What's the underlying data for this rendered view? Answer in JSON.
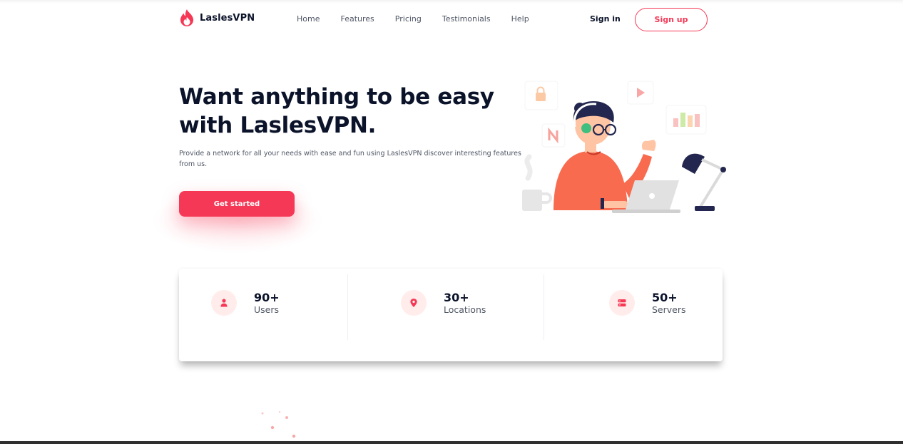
{
  "brand": {
    "name": "LaslesVPN",
    "color": "#f53855"
  },
  "nav": {
    "items": [
      {
        "label": "Home"
      },
      {
        "label": "Features"
      },
      {
        "label": "Pricing"
      },
      {
        "label": "Testimonials"
      },
      {
        "label": "Help"
      }
    ],
    "signin_label": "Sign in",
    "signup_label": "Sign up"
  },
  "hero": {
    "title": "Want anything to be easy with LaslesVPN.",
    "description": "Provide a network for all your needs with ease and fun using LaslesVPN discover interesting features from us.",
    "cta_label": "Get started"
  },
  "stats": [
    {
      "value": "90+",
      "label": "Users",
      "icon": "user-icon"
    },
    {
      "value": "30+",
      "label": "Locations",
      "icon": "location-pin-icon"
    },
    {
      "value": "50+",
      "label": "Servers",
      "icon": "server-icon"
    }
  ]
}
